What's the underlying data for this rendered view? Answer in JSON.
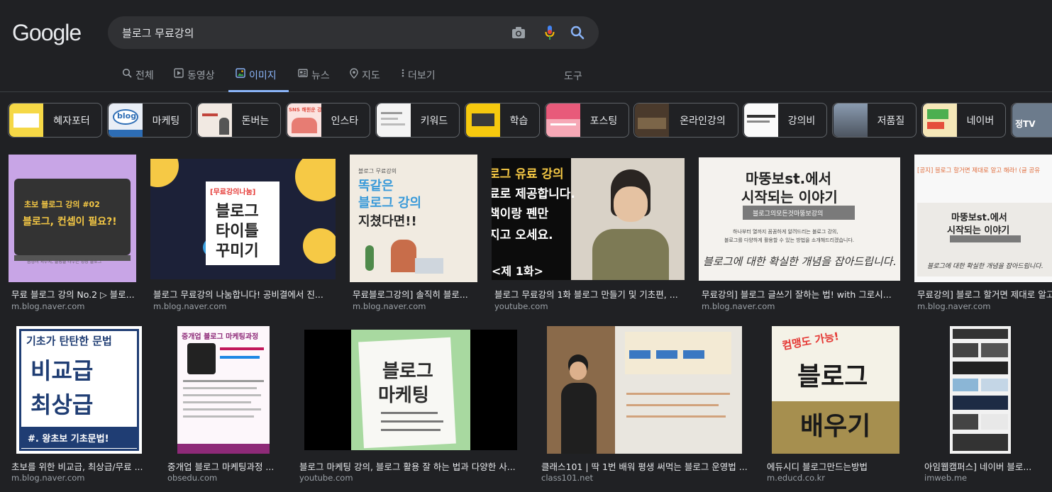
{
  "header": {
    "logo": "Google",
    "search": {
      "value": "블로그 무료강의"
    }
  },
  "tabs": [
    {
      "label": "전체"
    },
    {
      "label": "동영상"
    },
    {
      "label": "이미지"
    },
    {
      "label": "뉴스"
    },
    {
      "label": "지도"
    },
    {
      "label": "더보기"
    }
  ],
  "tools_label": "도구",
  "chips": [
    {
      "label": "혜자포터",
      "thumb_text": ""
    },
    {
      "label": "마케팅",
      "thumb_text": "blog"
    },
    {
      "label": "돈버는",
      "thumb_text": ""
    },
    {
      "label": "인스타",
      "thumb_text": "SNS 해원운 강의"
    },
    {
      "label": "키워드",
      "thumb_text": ""
    },
    {
      "label": "학습",
      "thumb_text": ""
    },
    {
      "label": "포스팅",
      "thumb_text": ""
    },
    {
      "label": "온라인강의",
      "thumb_text": ""
    },
    {
      "label": "강의비",
      "thumb_text": ""
    },
    {
      "label": "저품질",
      "thumb_text": ""
    },
    {
      "label": "네이버",
      "thumb_text": ""
    },
    {
      "label": "",
      "thumb_text": "정TV"
    }
  ],
  "results_row1": [
    {
      "caption": "무료 블로그 강의 No.2 ▷ 블로...",
      "source": "m.blog.naver.com",
      "img_text": {
        "line1": "초보 블로그 강의 #02",
        "line2": "블로그, 컨셉이 필요?!",
        "footer": "금정녀 괴수치, 블링을 나누는 성장 블로그"
      }
    },
    {
      "caption": "블로그 무료강의 나눔합니다! 공비결에서 진...",
      "source": "m.blog.naver.com",
      "img_text": {
        "tag": "[무료강의나눔]",
        "line1": "블로그",
        "line2": "타이틀",
        "line3": "꾸미기"
      }
    },
    {
      "caption": "무료블로그강의] 솔직히 블로...",
      "source": "m.blog.naver.com",
      "img_text": {
        "small": "블로그 무료강의",
        "line1": "똑같은",
        "line2": "블로그 강의",
        "line3": "지쳤다면!!"
      }
    },
    {
      "caption": "블로그 무료강의 1화 블로그 만들기 및 기초편, ...",
      "source": "youtube.com",
      "img_text": {
        "line1": "로그 유료 강의",
        "line2": "료로 제공합니다.",
        "line3": "책이랑 펜만",
        "line4": "지고 오세요.",
        "line5": "<제 1화>"
      }
    },
    {
      "caption": "무료강의] 블로그 글쓰기 잘하는 법! with 그로시...",
      "source": "m.blog.naver.com",
      "img_text": {
        "line1": "마뚱보st.에서",
        "line2": "시작되는 이야기",
        "bar": "블로그의모든것마뚱보강의",
        "desc1": "하나부터 열까지 꼼꼼하게 알려드리는 블로그 강의,",
        "desc2": "블로그를 다양하게 활용할 수 있는 방법을 소개해드리겠습니다.",
        "hand": "블로그에 대한 확실한 개념을 잡아드립니다."
      }
    },
    {
      "caption": "무료강의] 블로그 할거면 제대로 알고 해라! (글 공...",
      "source": "m.blog.naver.com",
      "img_text": {
        "top": "[공지] 블로그 할거면 제대로 알고 해라! (글 공유",
        "line1": "마뚱보st.에서",
        "line2": "시작되는 이야기",
        "hand": "블로그에 대한 확실한 개념을 잡아드립니다."
      }
    }
  ],
  "results_row2": [
    {
      "caption": "초보를 위한 비교급, 최상급/무료 ...",
      "source": "m.blog.naver.com",
      "img_text": {
        "line1": "기초가 탄탄한 문법",
        "line2": "비교급",
        "line3": "최상급",
        "footer": "#. 왕초보 기초문법!"
      }
    },
    {
      "caption": "중개업 블로그 마케팅과정 ...",
      "source": "obsedu.com",
      "img_text": {
        "line1": "중개업 블로그 마케팅과정"
      }
    },
    {
      "caption": "블로그 마케팅 강의, 블로그 활용 잘 하는 법과 다양한 사...",
      "source": "youtube.com",
      "img_text": {
        "line1": "블로그",
        "line2": "마케팅"
      }
    },
    {
      "caption": "클래스101 | 딱 1번 배워 평생 써먹는 블로그 운영법 ...",
      "source": "class101.net",
      "img_text": {}
    },
    {
      "caption": "에듀시디 블로그만드는방법",
      "source": "m.educd.co.kr",
      "img_text": {
        "tag": "컴맹도 가능!",
        "line1": "블로그",
        "line2": "배우기"
      }
    },
    {
      "caption": "아임웹캠퍼스] 네이버 블로...",
      "source": "imweb.me",
      "img_text": {}
    }
  ],
  "colors": {
    "accent": "#8ab4f8",
    "background": "#202124"
  }
}
